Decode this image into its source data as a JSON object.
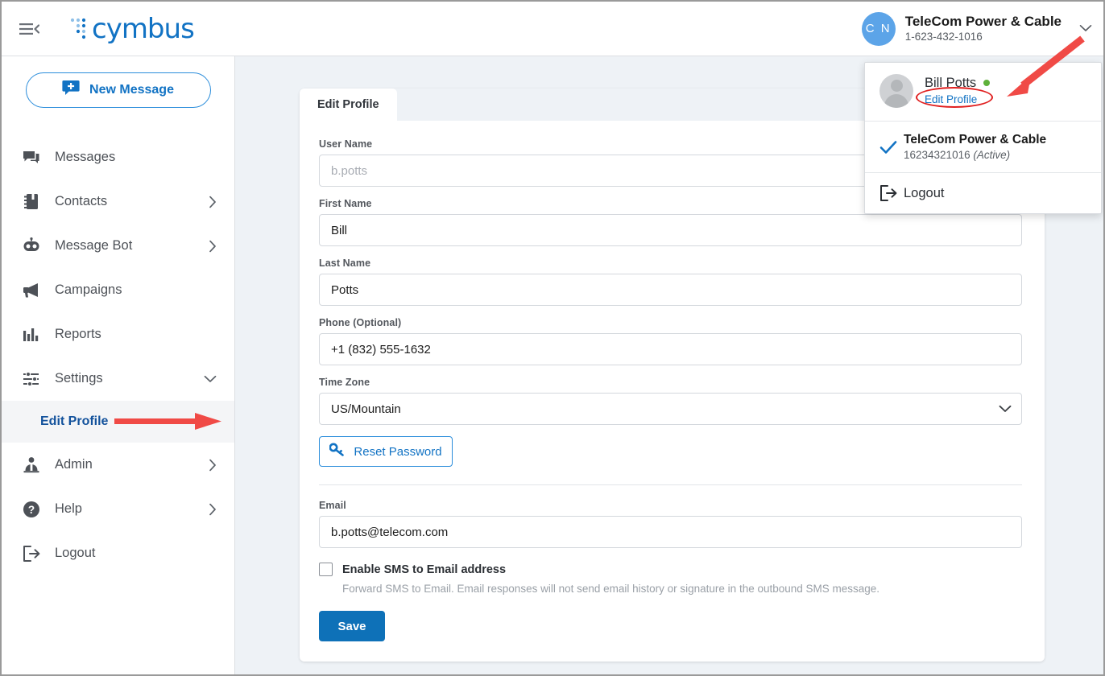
{
  "header": {
    "menu_toggle_icon": "hamburger-collapse-icon",
    "logo_text": "cymbus",
    "account_initials": "C N",
    "account_name": "TeleCom Power & Cable",
    "account_phone": "1-623-432-1016",
    "caret_icon": "chevron-down-icon"
  },
  "sidebar": {
    "new_message_label": "New Message",
    "new_message_icon": "new-message-icon",
    "items": [
      {
        "label": "Messages",
        "icon": "messages-icon",
        "chevron": false
      },
      {
        "label": "Contacts",
        "icon": "contacts-icon",
        "chevron": true
      },
      {
        "label": "Message Bot",
        "icon": "robot-icon",
        "chevron": true
      },
      {
        "label": "Campaigns",
        "icon": "megaphone-icon",
        "chevron": false
      },
      {
        "label": "Reports",
        "icon": "bar-chart-icon",
        "chevron": false
      },
      {
        "label": "Settings",
        "icon": "sliders-icon",
        "chevron": true,
        "expanded": true
      },
      {
        "label": "Admin",
        "icon": "admin-user-icon",
        "chevron": true
      },
      {
        "label": "Help",
        "icon": "help-circle-icon",
        "chevron": true
      },
      {
        "label": "Logout",
        "icon": "logout-icon",
        "chevron": false
      }
    ],
    "sub_item": {
      "label": "Edit Profile",
      "active": true
    }
  },
  "main": {
    "tab": {
      "label": "Edit Profile",
      "active": true
    },
    "fields": {
      "username": {
        "label": "User Name",
        "value": "",
        "placeholder": "b.potts"
      },
      "first_name": {
        "label": "First Name",
        "value": "Bill"
      },
      "last_name": {
        "label": "Last Name",
        "value": "Potts"
      },
      "phone": {
        "label": "Phone (Optional)",
        "value": "+1 (832) 555-1632"
      },
      "timezone": {
        "label": "Time Zone",
        "value": "US/Mountain",
        "chevron_icon": "chevron-down-icon"
      },
      "email": {
        "label": "Email",
        "value": "b.potts@telecom.com"
      }
    },
    "reset_password": {
      "label": "Reset Password",
      "icon": "key-icon"
    },
    "sms_checkbox": {
      "label": "Enable SMS to Email address",
      "checked": false,
      "help": "Forward SMS to Email. Email responses will not send email history or signature in the outbound SMS message."
    },
    "save_label": "Save"
  },
  "user_dropdown": {
    "avatar_icon": "user-avatar-placeholder-icon",
    "user_name": "Bill Potts",
    "status": "online",
    "edit_profile_link": "Edit Profile",
    "account": {
      "check_icon": "check-icon",
      "name": "TeleCom Power & Cable",
      "number": "16234321016",
      "state": "(Active)"
    },
    "logout": {
      "label": "Logout",
      "icon": "logout-icon"
    }
  },
  "annotations": {
    "header_arrow": "red-arrow-pointing-to-edit-profile-link",
    "sidebar_arrow": "red-arrow-pointing-to-edit-profile-menu-item",
    "edit_profile_ellipse": "red-ellipse-highlight"
  },
  "colors": {
    "brand_blue": "#1273c4",
    "save_blue": "#0e71b8",
    "annotation_red": "#e8413c",
    "status_green": "#5eb13a",
    "canvas": "#eef2f6"
  }
}
